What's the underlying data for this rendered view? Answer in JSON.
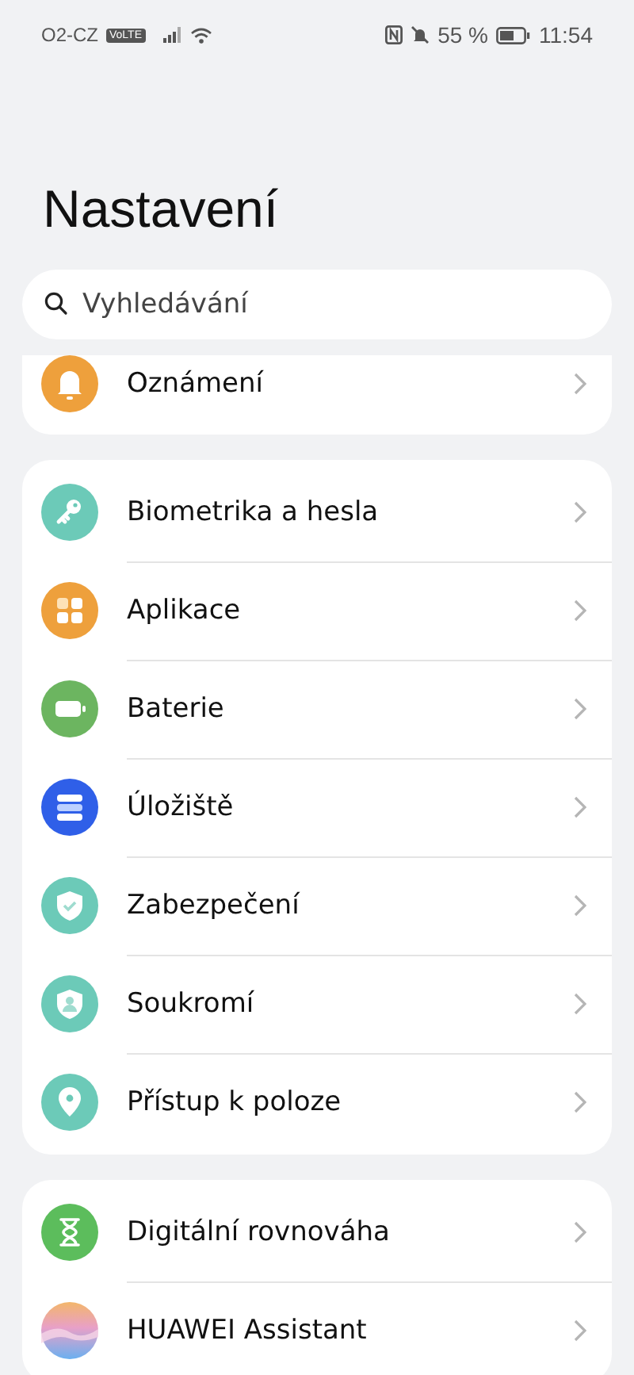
{
  "status_bar": {
    "carrier": "O2-CZ",
    "volte": "VoLTE",
    "battery_percent": "55 %",
    "time": "11:54"
  },
  "title": "Nastavení",
  "search": {
    "placeholder": "Vyhledávání"
  },
  "groups": [
    {
      "items": [
        {
          "label": "Oznámení",
          "kind": "bell",
          "color": "#eea03c"
        }
      ]
    },
    {
      "items": [
        {
          "label": "Biometrika a hesla",
          "kind": "key",
          "color": "#6ccab8"
        },
        {
          "label": "Aplikace",
          "kind": "apps",
          "color": "#eea03c"
        },
        {
          "label": "Baterie",
          "kind": "battery",
          "color": "#6cb560"
        },
        {
          "label": "Úložiště",
          "kind": "storage",
          "color": "#2f5fe8"
        },
        {
          "label": "Zabezpečení",
          "kind": "shield-check",
          "color": "#6ccab8"
        },
        {
          "label": "Soukromí",
          "kind": "shield-person",
          "color": "#6ccab8"
        },
        {
          "label": "Přístup k poloze",
          "kind": "pin",
          "color": "#6ccab8"
        }
      ]
    },
    {
      "items": [
        {
          "label": "Digitální rovnováha",
          "kind": "hourglass",
          "color": "#5cbd5c"
        },
        {
          "label": "HUAWEI Assistant",
          "kind": "gradient",
          "color": "#e8a0c8"
        }
      ]
    }
  ]
}
